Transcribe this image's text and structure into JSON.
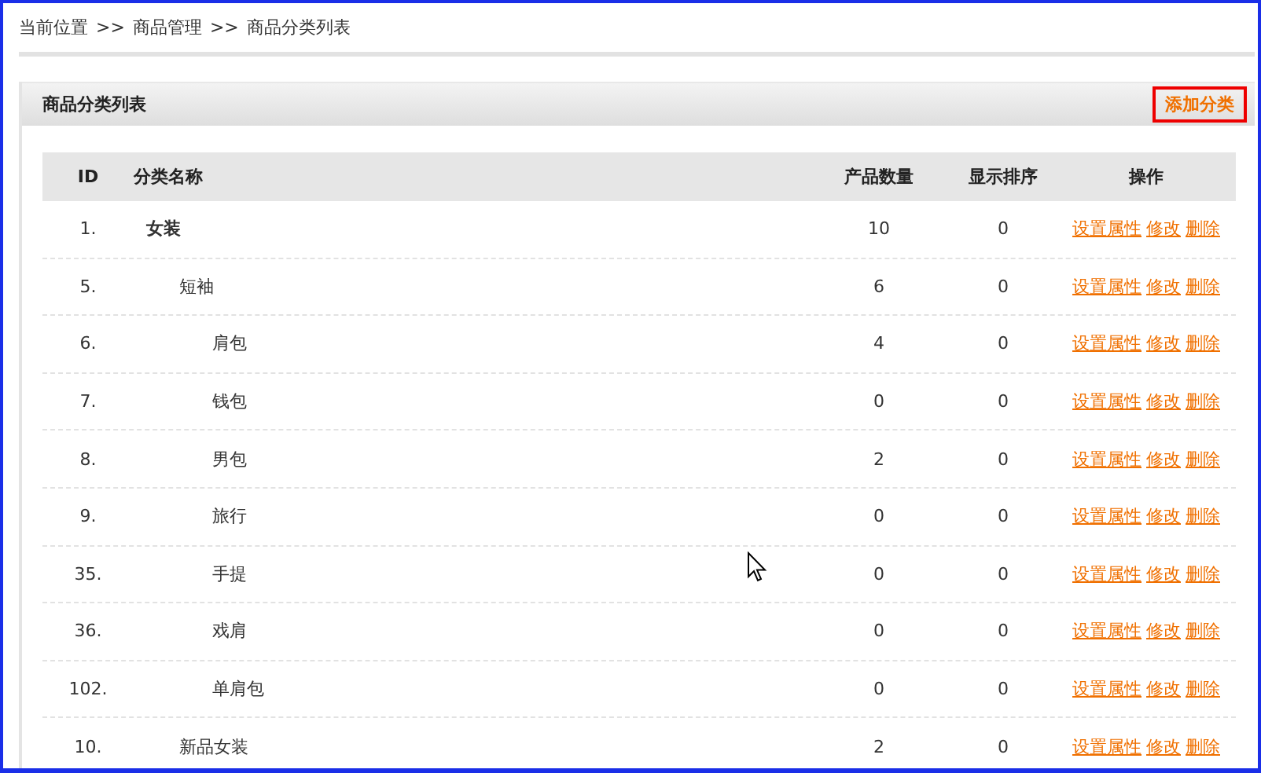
{
  "breadcrumb": [
    "当前位置",
    ">>",
    "商品管理",
    ">>",
    "商品分类列表"
  ],
  "panel": {
    "title": "商品分类列表",
    "add_button": "添加分类"
  },
  "table": {
    "columns": [
      "ID",
      "分类名称",
      "产品数量",
      "显示排序",
      "操作"
    ],
    "rows": [
      {
        "id": "1.",
        "name": "女装",
        "count": "10",
        "order": "0",
        "actions": [
          "设置属性",
          "修改",
          "删除"
        ],
        "children": [
          {
            "id": "5.",
            "name": "短袖",
            "count": "6",
            "order": "0",
            "actions": [
              "设置属性",
              "修改",
              "删除"
            ],
            "children": [
              {
                "id": "6.",
                "name": "肩包",
                "count": "4",
                "order": "0",
                "actions": [
                  "设置属性",
                  "修改",
                  "删除"
                ]
              },
              {
                "id": "7.",
                "name": "钱包",
                "count": "0",
                "order": "0",
                "actions": [
                  "设置属性",
                  "修改",
                  "删除"
                ]
              },
              {
                "id": "8.",
                "name": "男包",
                "count": "2",
                "order": "0",
                "actions": [
                  "设置属性",
                  "修改",
                  "删除"
                ]
              },
              {
                "id": "9.",
                "name": "旅行",
                "count": "0",
                "order": "0",
                "actions": [
                  "设置属性",
                  "修改",
                  "删除"
                ]
              },
              {
                "id": "35.",
                "name": "手提",
                "count": "0",
                "order": "0",
                "actions": [
                  "设置属性",
                  "修改",
                  "删除"
                ]
              },
              {
                "id": "36.",
                "name": "戏肩",
                "count": "0",
                "order": "0",
                "actions": [
                  "设置属性",
                  "修改",
                  "删除"
                ]
              },
              {
                "id": "102.",
                "name": "单肩包",
                "count": "0",
                "order": "0",
                "actions": [
                  "设置属性",
                  "修改",
                  "删除"
                ]
              }
            ]
          },
          {
            "id": "10.",
            "name": "新品女装",
            "count": "2",
            "order": "0",
            "actions": [
              "设置属性",
              "修改",
              "删除"
            ]
          }
        ]
      }
    ]
  }
}
